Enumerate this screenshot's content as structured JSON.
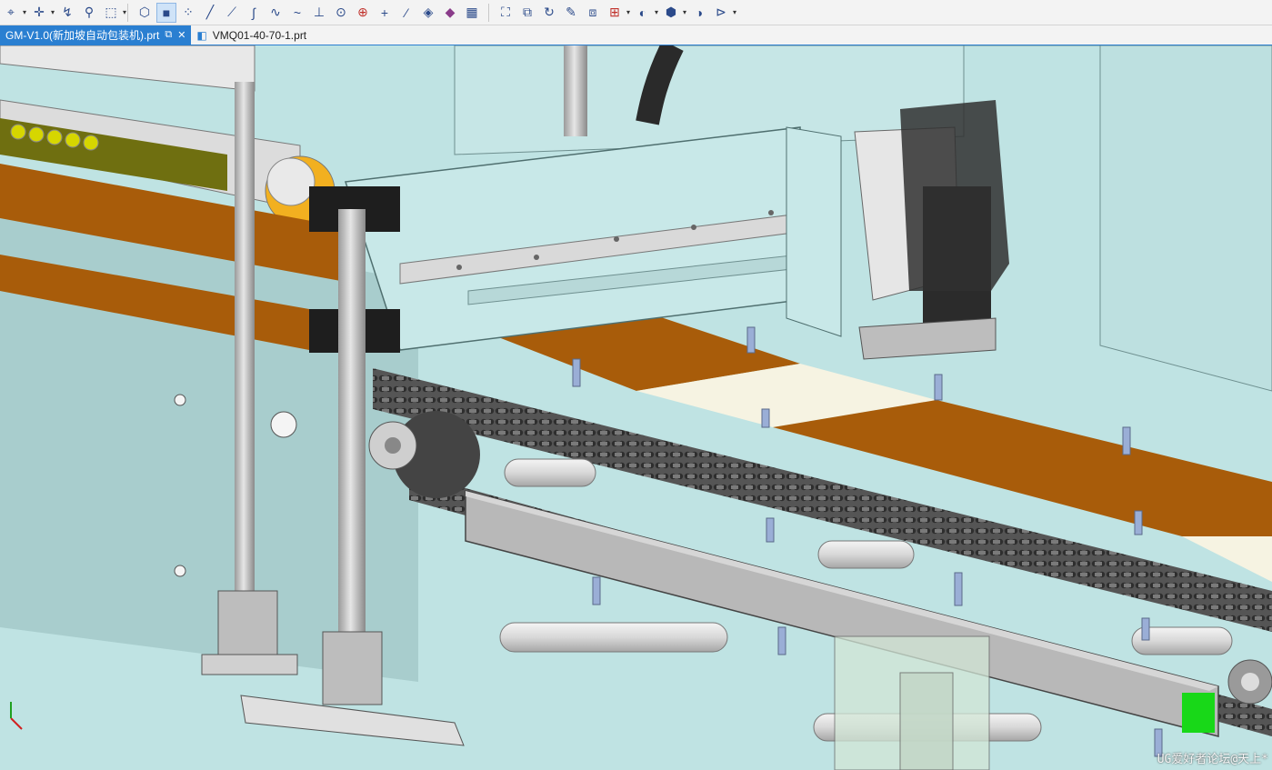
{
  "toolbar": {
    "groups": [
      [
        "select-icon",
        "snap-icon",
        "curve-icon",
        "node-icon",
        "box-select-icon"
      ],
      [
        "shaded-view-icon",
        "solid-view-icon",
        "point-icon",
        "line-icon",
        "line-tangent-icon",
        "spline-icon",
        "curve-edit-icon",
        "wave-icon",
        "crosshair-icon",
        "center-point-icon",
        "circle-target-icon",
        "plus-icon",
        "slash-icon",
        "sheet-icon",
        "layers-icon",
        "grid-icon"
      ],
      [
        "fit-icon",
        "zoom-icon",
        "rotate-icon",
        "pan-icon",
        "clip-icon",
        "view-orient-icon",
        "render-icon",
        "cube-icon",
        "sphere-icon",
        "display-icon"
      ]
    ]
  },
  "tabs": [
    {
      "label": "GM-V1.0(新加坡自动包装机).prt",
      "active": true
    },
    {
      "label": "VMQ01-40-70-1.prt",
      "active": false
    }
  ],
  "watermark": "UG爱好者论坛@天上*",
  "colors": {
    "background": "#bfe3e3",
    "frame": "#c8e8e8",
    "plate": "#a85c0a",
    "chain": "#3a3a3a",
    "rail": "#d9d9d9",
    "tab_active": "#2a7fd1"
  }
}
